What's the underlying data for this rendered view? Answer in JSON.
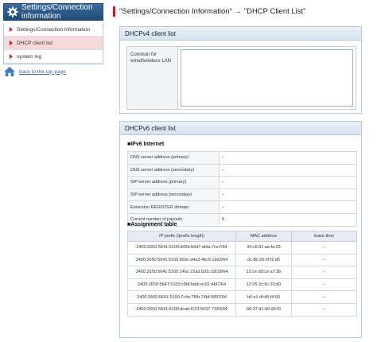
{
  "sidebar": {
    "title": "Settings/Connection information",
    "items": [
      {
        "label": "Settings/Connection information"
      },
      {
        "label": "DHCP client list"
      },
      {
        "label": "system log"
      }
    ],
    "back_link": "back to the top page"
  },
  "breadcrumb": "\"Settings/Connection Information\" → \"DHCP Client List\"",
  "dhcpv4": {
    "title": "DHCPv4 client list",
    "label": "Common for wired/wireless LAN",
    "value": ""
  },
  "dhcpv6": {
    "title": "DHCPv6 client list",
    "ipv6_title": "■IPv6 Internet",
    "rows": [
      {
        "key": "DNS server address (primary)",
        "value": "–"
      },
      {
        "key": "DNS server address (secondary)",
        "value": "–"
      },
      {
        "key": "SIP server address (primary)",
        "value": "–"
      },
      {
        "key": "SIP server address (secondary)",
        "value": "–"
      },
      {
        "key": "Extension REGISTER domain",
        "value": "–"
      },
      {
        "key": "Current number of payouts",
        "value": "6"
      }
    ],
    "assignment_title": "■Assignment table",
    "columns": [
      "IP prefix (/prefix length)",
      "MAC address",
      "lease time"
    ],
    "assignments": [
      {
        "prefix": "2400:2650:5641:5100:d42b:b9d7:afda:7ce7/64",
        "mac": "94:c6:91:aa:fa:29",
        "lease": "–"
      },
      {
        "prefix": "2400:2650:5641:5100:b59c:d4a3:4bc6:1bd3/64",
        "mac": "dc:8b:28:0f:f2:d5",
        "lease": "–"
      },
      {
        "prefix": "2400:2650:5641:5100:14bc:22ad:5d1c:b818/64",
        "mac": "12:ce:dd:ce:a7:3b",
        "lease": "–"
      },
      {
        "prefix": "2400:2650:5641:5100:c9f4:fabb:ec01:4fd7/64",
        "mac": "12:25:3c:9c:33:d0",
        "lease": "–"
      },
      {
        "prefix": "2400:2650:5641:5100:7c4c:7f0b:74bf:5897/64",
        "mac": "b6:e1:df:d5:f4:65",
        "lease": "–"
      },
      {
        "prefix": "2400:2650:5641:5100:dcab:f133:5637:7333/64",
        "mac": "b6:37:d1:90:d0:f0",
        "lease": "–"
      }
    ]
  }
}
